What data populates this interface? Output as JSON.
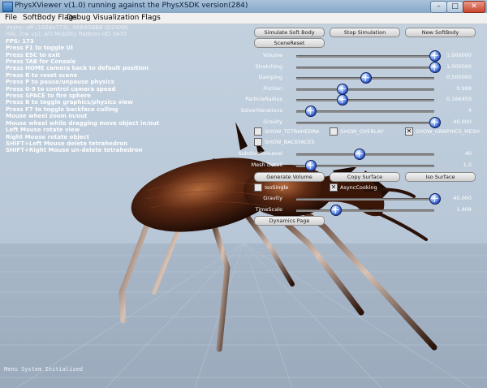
{
  "window": {
    "title": "PhysXViewer v(1.0) running against the PhysXSDK version(284)",
    "min_glyph": "–",
    "max_glyph": "□",
    "close_glyph": "✕"
  },
  "menu": {
    "items": [
      "File",
      "SoftBody Flags",
      "Debug Visualization Flags"
    ]
  },
  "info_lines": [
    "Vsync: off (1024x773), X8R8G8B8 (D24X8)",
    "HAL (hw vp): ATI Mobility Radeon HD 3470",
    "FPS: 173",
    "Press F1 to toggle UI",
    "Press ESC to exit",
    "Press TAB for Console",
    "Press HOME camera back to default position",
    "Press R to reset scene",
    "Press P to pause/unpause physics",
    "Press 0-9 to control camera speed",
    "Press SPACE to fire sphere",
    "Press B to toggle graphics/physics view",
    "Press F7 to toggle backface culling",
    "Mouse wheel zoom in/out",
    "Mouse wheel while dragging move object in/out",
    "Left Mouse rotate view",
    "Right Mouse rotate object",
    "SHIFT+Left Mouse delete tetrahedron",
    "SHIFT+Right Mouse un-delete tetrahedron"
  ],
  "buttons": {
    "simulate_soft_body": "Simulate Soft Body",
    "stop_simulation": "Stop Simulation",
    "new_softbody": "New SoftBody",
    "scene_reset": "SceneReset",
    "generate_volume": "Generate Volume",
    "copy_surface": "Copy Surface",
    "iso_surface": "Iso Surface",
    "dynamics_page": "Dynamics Page"
  },
  "sliders": [
    {
      "label": "Volume",
      "value": "1.000000",
      "level": 1.0
    },
    {
      "label": "Stretching",
      "value": "1.000000",
      "level": 1.0
    },
    {
      "label": "Damping",
      "value": "0.500000",
      "level": 0.5
    },
    {
      "label": "Friction",
      "value": "0.999",
      "level": 0.33
    },
    {
      "label": "ParticleRadius",
      "value": "0.166459",
      "level": 0.33
    },
    {
      "label": "SolverIterations",
      "value": "4",
      "level": 0.1
    },
    {
      "label": "Gravity",
      "value": "40.000",
      "level": 1.0
    }
  ],
  "checkboxes": [
    {
      "label": "SHOW_TETRAHEDRA",
      "checked": false,
      "mark": ""
    },
    {
      "label": "SHOW_OVERLAY",
      "checked": false,
      "mark": ""
    },
    {
      "label": "SHOW_GRAPHICS_MESH",
      "checked": true,
      "mark": "✕"
    },
    {
      "label": "SHOW_BACKFACES",
      "checked": false,
      "mark": ""
    }
  ],
  "sliders2": [
    {
      "label": "SubdivisionLevel",
      "value": "40",
      "level": 0.45
    },
    {
      "label": "Mesh Detail",
      "value": "1.0",
      "level": 0.1
    }
  ],
  "checkboxes2": [
    {
      "label": "IsoSingle",
      "checked": false,
      "mark": ""
    },
    {
      "label": "AsyncCooking",
      "checked": true,
      "mark": "✕"
    }
  ],
  "sliders3": [
    {
      "label": "Gravity",
      "value": "40.000",
      "level": 1.0
    },
    {
      "label": "TimeScale",
      "value": "1.408",
      "level": 0.28
    }
  ],
  "status": {
    "text": "Menu System Initialized"
  }
}
